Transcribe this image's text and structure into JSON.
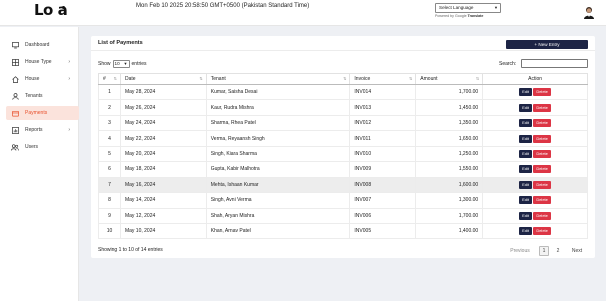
{
  "header": {
    "logo_text": "Lo a",
    "datetime": "Mon Feb 10 2025 20:58:50 GMT+0500 (Pakistan Standard Time)",
    "language_select": "Select Language",
    "powered_prefix": "Powered by Google",
    "powered_brand": "Translate"
  },
  "sidebar": {
    "items": [
      {
        "label": "Dashboard",
        "icon": "monitor-icon"
      },
      {
        "label": "House Type",
        "icon": "grid-icon",
        "chevron": "›"
      },
      {
        "label": "House",
        "icon": "home-icon",
        "chevron": "›"
      },
      {
        "label": "Tenants",
        "icon": "user-icon"
      },
      {
        "label": "Payments",
        "icon": "wallet-icon",
        "active": true
      },
      {
        "label": "Reports",
        "icon": "chart-icon",
        "chevron": "›"
      },
      {
        "label": "Users",
        "icon": "users-icon"
      }
    ]
  },
  "main": {
    "title": "List of Payments",
    "new_entry_label": "+ New Entry",
    "show_label": "Show",
    "entries_value": "10",
    "entries_label": "entries",
    "search_label": "Search:",
    "search_value": "",
    "columns": [
      "#",
      "Date",
      "Tenant",
      "Invoice",
      "Amount",
      "Action"
    ],
    "rows": [
      {
        "num": "1",
        "date": "May 28, 2024",
        "tenant": "Kumar, Saisha Desai",
        "invoice": "INV014",
        "amount": "1,700.00"
      },
      {
        "num": "2",
        "date": "May 26, 2024",
        "tenant": "Kaur, Rudra Mishra",
        "invoice": "INV013",
        "amount": "1,450.00"
      },
      {
        "num": "3",
        "date": "May 24, 2024",
        "tenant": "Sharma, Rhea Patel",
        "invoice": "INV012",
        "amount": "1,350.00"
      },
      {
        "num": "4",
        "date": "May 22, 2024",
        "tenant": "Verma, Reyaansh Singh",
        "invoice": "INV011",
        "amount": "1,650.00"
      },
      {
        "num": "5",
        "date": "May 20, 2024",
        "tenant": "Singh, Kiara Sharma",
        "invoice": "INV010",
        "amount": "1,250.00"
      },
      {
        "num": "6",
        "date": "May 18, 2024",
        "tenant": "Gupta, Kabir Malhotra",
        "invoice": "INV009",
        "amount": "1,550.00"
      },
      {
        "num": "7",
        "date": "May 16, 2024",
        "tenant": "Mehta, Ishaan Kumar",
        "invoice": "INV008",
        "amount": "1,600.00",
        "highlight": true
      },
      {
        "num": "8",
        "date": "May 14, 2024",
        "tenant": "Singh, Avni Verma",
        "invoice": "INV007",
        "amount": "1,300.00"
      },
      {
        "num": "9",
        "date": "May 12, 2024",
        "tenant": "Shah, Aryan Mishra",
        "invoice": "INV006",
        "amount": "1,700.00"
      },
      {
        "num": "10",
        "date": "May 10, 2024",
        "tenant": "Khan, Arnav Patel",
        "invoice": "INV005",
        "amount": "1,400.00"
      }
    ],
    "edit_label": "Edit",
    "delete_label": "Delete",
    "info": "Showing 1 to 10 of 14 entries",
    "pagination": {
      "previous": "Previous",
      "pages": [
        "1",
        "2"
      ],
      "current": "1",
      "next": "Next"
    }
  },
  "colors": {
    "accent": "#e8502c",
    "primary_dark": "#1d2445",
    "danger": "#dc3545"
  }
}
